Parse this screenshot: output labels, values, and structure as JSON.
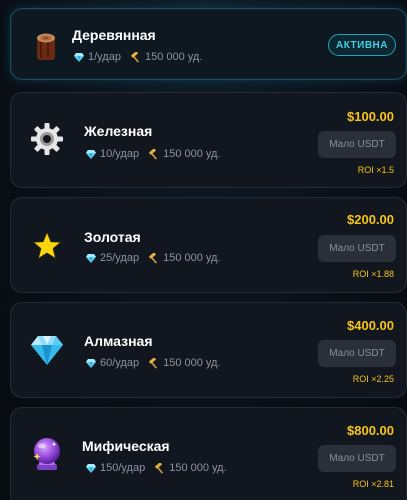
{
  "currency_gem": "💎",
  "items": [
    {
      "name": "Деревянная",
      "icon": "wood-log-icon",
      "per_hit": "1/удар",
      "durability": "150 000 уд.",
      "status": "АКТИВНА"
    },
    {
      "name": "Железная",
      "icon": "gear-icon",
      "per_hit": "10/удар",
      "durability": "150 000 уд.",
      "price": "$100.00",
      "button": "Мало USDT",
      "roi": "ROI ×1.5"
    },
    {
      "name": "Золотая",
      "icon": "star-icon",
      "per_hit": "25/удар",
      "durability": "150 000 уд.",
      "price": "$200.00",
      "button": "Мало USDT",
      "roi": "ROI ×1.88"
    },
    {
      "name": "Алмазная",
      "icon": "diamond-icon",
      "per_hit": "60/удар",
      "durability": "150 000 уд.",
      "price": "$400.00",
      "button": "Мало USDT",
      "roi": "ROI ×2.25"
    },
    {
      "name": "Мифическая",
      "icon": "crystal-ball-icon",
      "per_hit": "150/удар",
      "durability": "150 000 уд.",
      "price": "$800.00",
      "button": "Мало USDT",
      "roi": "ROI ×2.81"
    }
  ],
  "colors": {
    "accent": "#3fd0e8",
    "price": "#f5c518",
    "card": "#12161e",
    "muted": "#8a94a4"
  }
}
